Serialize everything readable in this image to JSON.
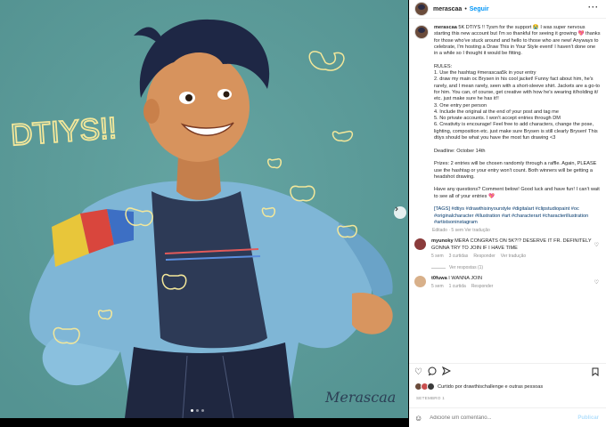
{
  "header": {
    "username": "merascaa",
    "separator": "•",
    "follow_label": "Seguir",
    "more_icon": "more-dots-icon"
  },
  "caption": {
    "username": "merascaa",
    "text": "5K DTIYS !! Tysm for the support 😭 I was super nervous starting this new account but I'm so thankful for seeing it growing 💖 thanks for those who've stuck around and hello to those who are new! Anyways to celebrate, I'm hosting a Draw This in Your Style event! I haven't done one in a while so I thought it would be fitting.\n\nRULES:\n1. Use the hashtag #merascaa5k in your entry\n2. draw my main oc Brysen in his cool jacket! Funny fact about him, he's rarely, and I mean rarely, seen with a short-sleeve shirt. Jackets are a go-to for him. You can, of course, get creative with how he's wearing it/holding it/ etc. just make sure he has it!!\n3. One entry per person\n4. Include the original at the end of your post and tag me\n5. No private accounts. I won't accept entries through DM\n6. Creativity is encourage! Feel free to add characters, change the pose, lighting, composition etc. just make sure Brysen is still clearly Brysen! This dtiys should be what you have the most fun drawing <3\n\nDeadline: October 14th\n\nPrizes: 2 entries will be chosen randomly through a raffle. Again, PLEASE use the hashtag or your entry won't count. Both winners will be getting a headshot drawing.\n\nHave any questions? Comment below! Good luck and have fun! I can't wait to see all of your entries 💖\n\n",
    "tags": "[TAGS] #dtiys #drawthisinyourstyle #digitalart #clipstudiopaint #oc #originalcharacter #illustration #art #characterart #characterillustration #artistsoninstagram",
    "meta": "Editado · 5 sem   Ver tradução"
  },
  "comments": [
    {
      "username": "myunoky",
      "text": "MERA CONGRATS ON 5K?!? DESERVE IT FR. DEFINITELY GONNA TRY TO JOIN IF I HAVE TIME",
      "time": "5 sem",
      "likes": "3 curtidas",
      "reply": "Responder",
      "translate": "Ver tradução",
      "view_replies": "Ver respostas (1)",
      "avatar_color": "#8a3b3b"
    },
    {
      "username": "t0fuwa",
      "text": "I WANNA JOIN",
      "time": "5 sem",
      "likes": "1 curtida",
      "reply": "Responder",
      "translate": "",
      "view_replies": "",
      "avatar_color": "#d8b08a"
    }
  ],
  "actions": {
    "like_icon": "heart-icon",
    "comment_icon": "comment-icon",
    "share_icon": "share-icon",
    "save_icon": "bookmark-icon"
  },
  "likes_text": "Curtido por drawthischallenge e outras pessoas",
  "date": "SETEMBRO 1",
  "add_comment": {
    "emoji_icon": "emoji-icon",
    "placeholder": "Adicione um comentário...",
    "publish_label": "Publicar"
  },
  "artwork": {
    "text": "DTIYS!!",
    "signature": "Merascaa"
  },
  "carousel": {
    "count": 3,
    "active": 1
  },
  "colors": {
    "accent": "#0095f6",
    "link": "#00376b",
    "background": "#5f9e9c"
  }
}
